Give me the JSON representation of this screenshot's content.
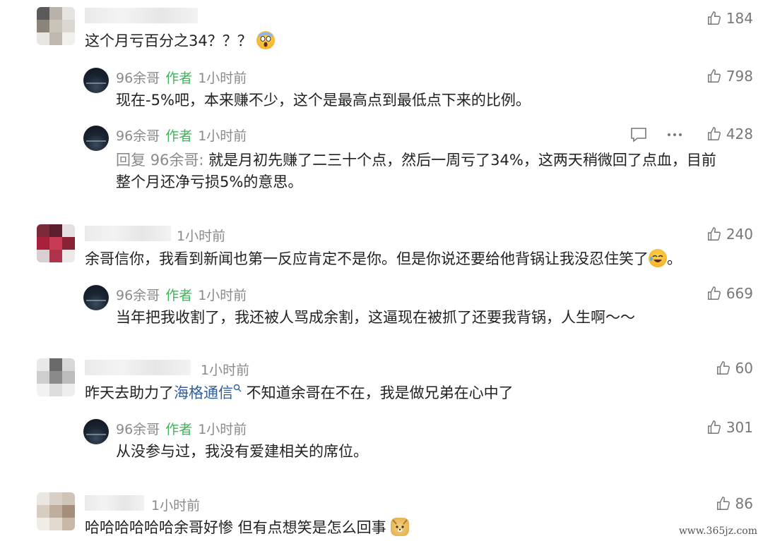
{
  "comments": [
    {
      "likes": "184",
      "text": "这个月亏百分之34？？？",
      "replies": [
        {
          "name": "96余哥",
          "badge": "作者",
          "time": "1小时前",
          "likes": "798",
          "text": "现在-5%吧，本来赚不少，这个是最高点到最低点下来的比例。"
        },
        {
          "name": "96余哥",
          "badge": "作者",
          "time": "1小时前",
          "likes": "428",
          "prefix": "回复 ",
          "reply_to": "96余哥:",
          "text1": " 就是月初先赚了二三十个点，然后一周亏了34%，这两天稍微回了点血，目前",
          "text2": "整个月还净亏损5%的意思。"
        }
      ]
    },
    {
      "time": "1小时前",
      "likes": "240",
      "text": "余哥信你，我看到新闻也第一反应肯定不是你。但是你说还要给他背锅让我没忍住笑了",
      "text_end": "。",
      "replies": [
        {
          "name": "96余哥",
          "badge": "作者",
          "time": "1小时前",
          "likes": "669",
          "text": "当年把我收割了，我还被人骂成余割，这逼现在被抓了还要我背锅，人生啊～～"
        }
      ]
    },
    {
      "time": "1小时前",
      "likes": "60",
      "text_before": "昨天去助力了",
      "link": "海格通信",
      "text_after": " 不知道余哥在不在，我是做兄弟在心中了",
      "replies": [
        {
          "name": "96余哥",
          "badge": "作者",
          "time": "1小时前",
          "likes": "301",
          "text": "从没参与过，我没有爱建相关的席位。"
        }
      ]
    },
    {
      "time": "1小时前",
      "likes": "86",
      "text": "哈哈哈哈哈哈余哥好惨 但有点想笑是怎么回事"
    }
  ],
  "icons": {
    "like": "thumbs-up-icon",
    "comment": "comment-icon",
    "more": "more-icon"
  },
  "colors": {
    "author": "#3eb55a",
    "link": "#2f5f9c",
    "meta": "#8a8a8a"
  },
  "watermark": "www.365jz.com"
}
